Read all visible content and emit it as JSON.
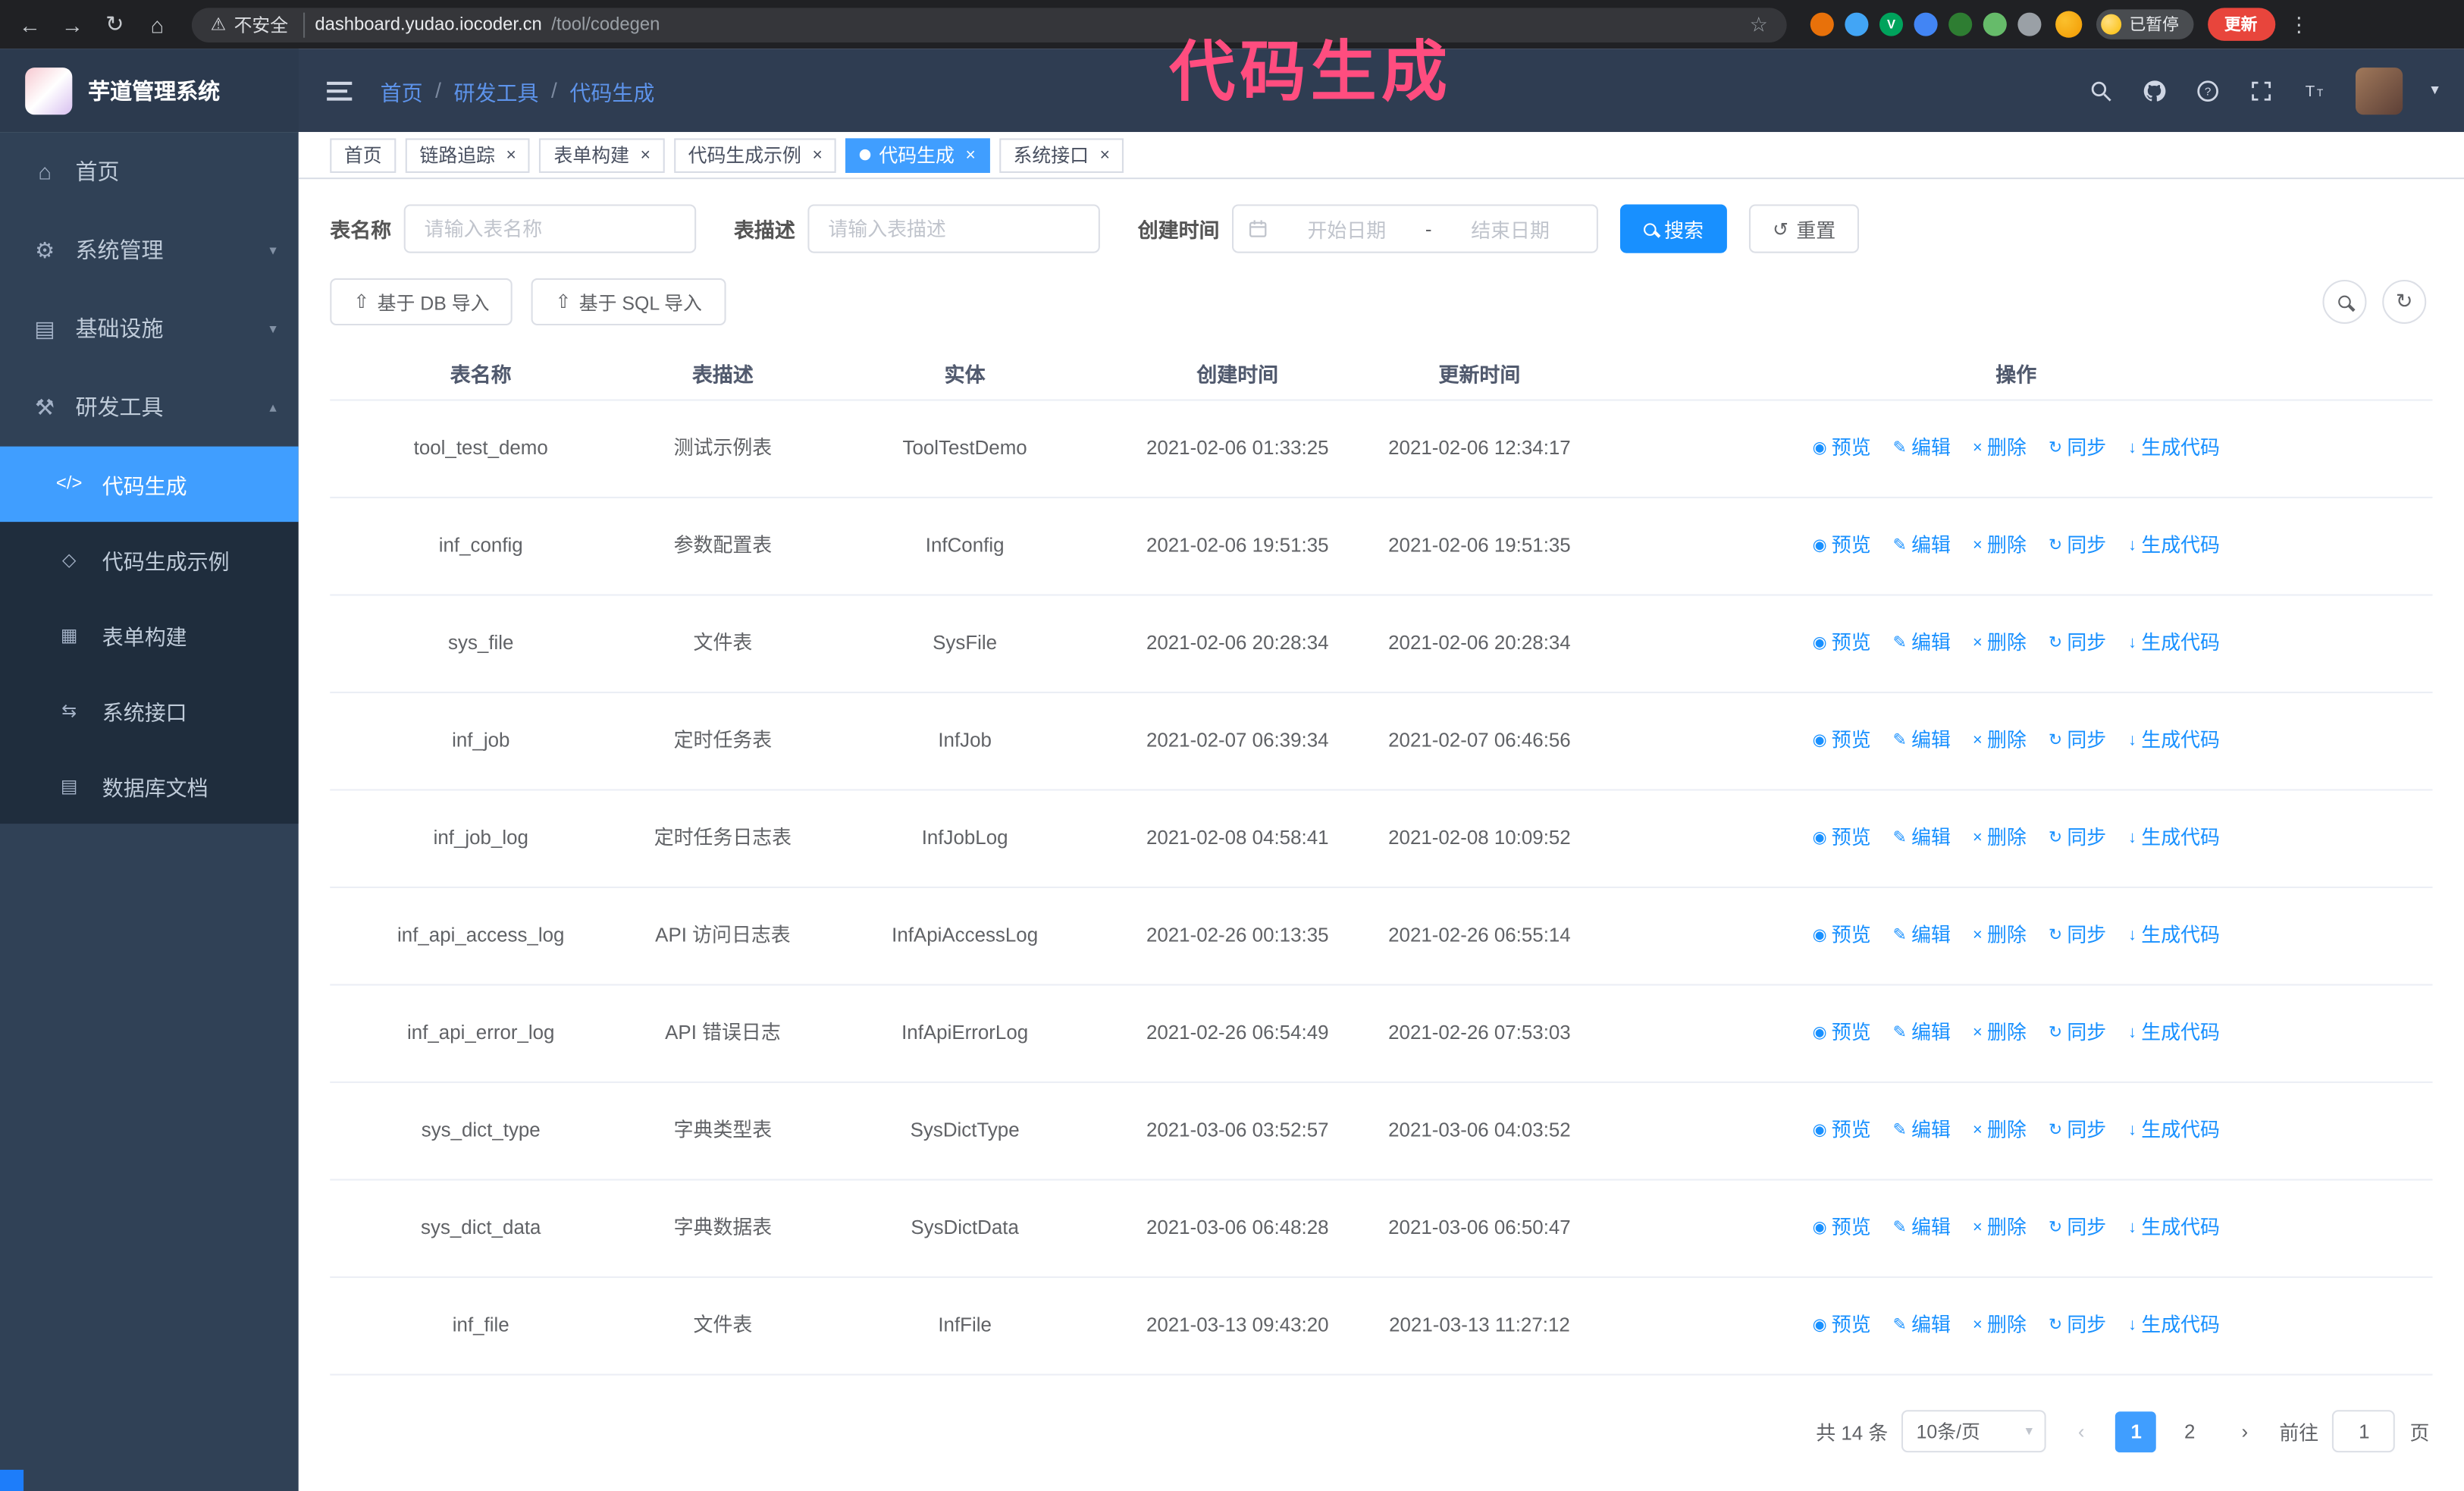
{
  "annotation": {
    "text": "代码生成"
  },
  "colors": {
    "accent": "#409eff",
    "primary_button": "#1890ff",
    "annotation": "#ff4d7f",
    "update_button": "#e8453c",
    "sidebar_bg": "#304156"
  },
  "browser": {
    "security_label": "不安全",
    "url_host": "dashboard.yudao.iocoder.cn",
    "url_path": "/tool/codegen",
    "paused_badge": "已暂停",
    "update_button": "更新",
    "extensions": [
      {
        "name": "extension-orange-icon",
        "color": "#e8710a",
        "glyph": ""
      },
      {
        "name": "extension-blue-drop-icon",
        "color": "#42a5f5",
        "glyph": ""
      },
      {
        "name": "extension-green-v-icon",
        "color": "#00a35c",
        "glyph": "V"
      },
      {
        "name": "extension-grid-icon",
        "color": "#4285f4",
        "glyph": ""
      },
      {
        "name": "extension-dark-green-icon",
        "color": "#2e7d32",
        "glyph": ""
      },
      {
        "name": "extension-leaf-icon",
        "color": "#66bb6a",
        "glyph": ""
      },
      {
        "name": "puzzle-icon",
        "color": "#9aa0a6",
        "glyph": ""
      }
    ]
  },
  "app": {
    "title": "芋道管理系统"
  },
  "breadcrumb": {
    "items": [
      "首页",
      "研发工具",
      "代码生成"
    ]
  },
  "sidebar": {
    "items": [
      {
        "name": "home",
        "label": "首页",
        "icon": "home"
      },
      {
        "name": "system",
        "label": "系统管理",
        "icon": "gear",
        "chevron": "down"
      },
      {
        "name": "infra",
        "label": "基础设施",
        "icon": "infra",
        "chevron": "down"
      },
      {
        "name": "dev-tools",
        "label": "研发工具",
        "icon": "tools",
        "chevron": "up"
      }
    ],
    "subitems": [
      {
        "name": "codegen",
        "label": "代码生成",
        "icon": "code",
        "active": true
      },
      {
        "name": "codegen-example",
        "label": "代码生成示例",
        "icon": "example",
        "active": false
      },
      {
        "name": "form-builder",
        "label": "表单构建",
        "icon": "form",
        "active": false
      },
      {
        "name": "api",
        "label": "系统接口",
        "icon": "api",
        "active": false
      },
      {
        "name": "db-doc",
        "label": "数据库文档",
        "icon": "db",
        "active": false
      }
    ]
  },
  "tabs": [
    {
      "name": "home",
      "label": "首页",
      "closable": false,
      "active": false
    },
    {
      "name": "tracing",
      "label": "链路追踪",
      "closable": true,
      "active": false
    },
    {
      "name": "form-builder",
      "label": "表单构建",
      "closable": true,
      "active": false
    },
    {
      "name": "codegen-example",
      "label": "代码生成示例",
      "closable": true,
      "active": false
    },
    {
      "name": "codegen",
      "label": "代码生成",
      "closable": true,
      "active": true
    },
    {
      "name": "api",
      "label": "系统接口",
      "closable": true,
      "active": false
    }
  ],
  "filters": {
    "table_name_label": "表名称",
    "table_name_placeholder": "请输入表名称",
    "table_desc_label": "表描述",
    "table_desc_placeholder": "请输入表描述",
    "create_time_label": "创建时间",
    "start_date_placeholder": "开始日期",
    "range_separator": "-",
    "end_date_placeholder": "结束日期",
    "search_button": "搜索",
    "reset_button": "重置"
  },
  "toolbar": {
    "import_db": "基于 DB 导入",
    "import_sql": "基于 SQL 导入"
  },
  "table": {
    "headers": [
      "表名称",
      "表描述",
      "实体",
      "创建时间",
      "更新时间",
      "操作"
    ],
    "actions": [
      "预览",
      "编辑",
      "删除",
      "同步",
      "生成代码"
    ],
    "rows": [
      [
        "tool_test_demo",
        "测试示例表",
        "ToolTestDemo",
        "2021-02-06 01:33:25",
        "2021-02-06 12:34:17"
      ],
      [
        "inf_config",
        "参数配置表",
        "InfConfig",
        "2021-02-06 19:51:35",
        "2021-02-06 19:51:35"
      ],
      [
        "sys_file",
        "文件表",
        "SysFile",
        "2021-02-06 20:28:34",
        "2021-02-06 20:28:34"
      ],
      [
        "inf_job",
        "定时任务表",
        "InfJob",
        "2021-02-07 06:39:34",
        "2021-02-07 06:46:56"
      ],
      [
        "inf_job_log",
        "定时任务日志表",
        "InfJobLog",
        "2021-02-08 04:58:41",
        "2021-02-08 10:09:52"
      ],
      [
        "inf_api_access_log",
        "API 访问日志表",
        "InfApiAccessLog",
        "2021-02-26 00:13:35",
        "2021-02-26 06:55:14"
      ],
      [
        "inf_api_error_log",
        "API 错误日志",
        "InfApiErrorLog",
        "2021-02-26 06:54:49",
        "2021-02-26 07:53:03"
      ],
      [
        "sys_dict_type",
        "字典类型表",
        "SysDictType",
        "2021-03-06 03:52:57",
        "2021-03-06 04:03:52"
      ],
      [
        "sys_dict_data",
        "字典数据表",
        "SysDictData",
        "2021-03-06 06:48:28",
        "2021-03-06 06:50:47"
      ],
      [
        "inf_file",
        "文件表",
        "InfFile",
        "2021-03-13 09:43:20",
        "2021-03-13 11:27:12"
      ]
    ]
  },
  "pagination": {
    "total": "共 14 条",
    "page_size": "10条/页",
    "pages": [
      "1",
      "2"
    ],
    "active_page": "1",
    "goto_label": "前往",
    "goto_value": "1",
    "unit": "页"
  }
}
